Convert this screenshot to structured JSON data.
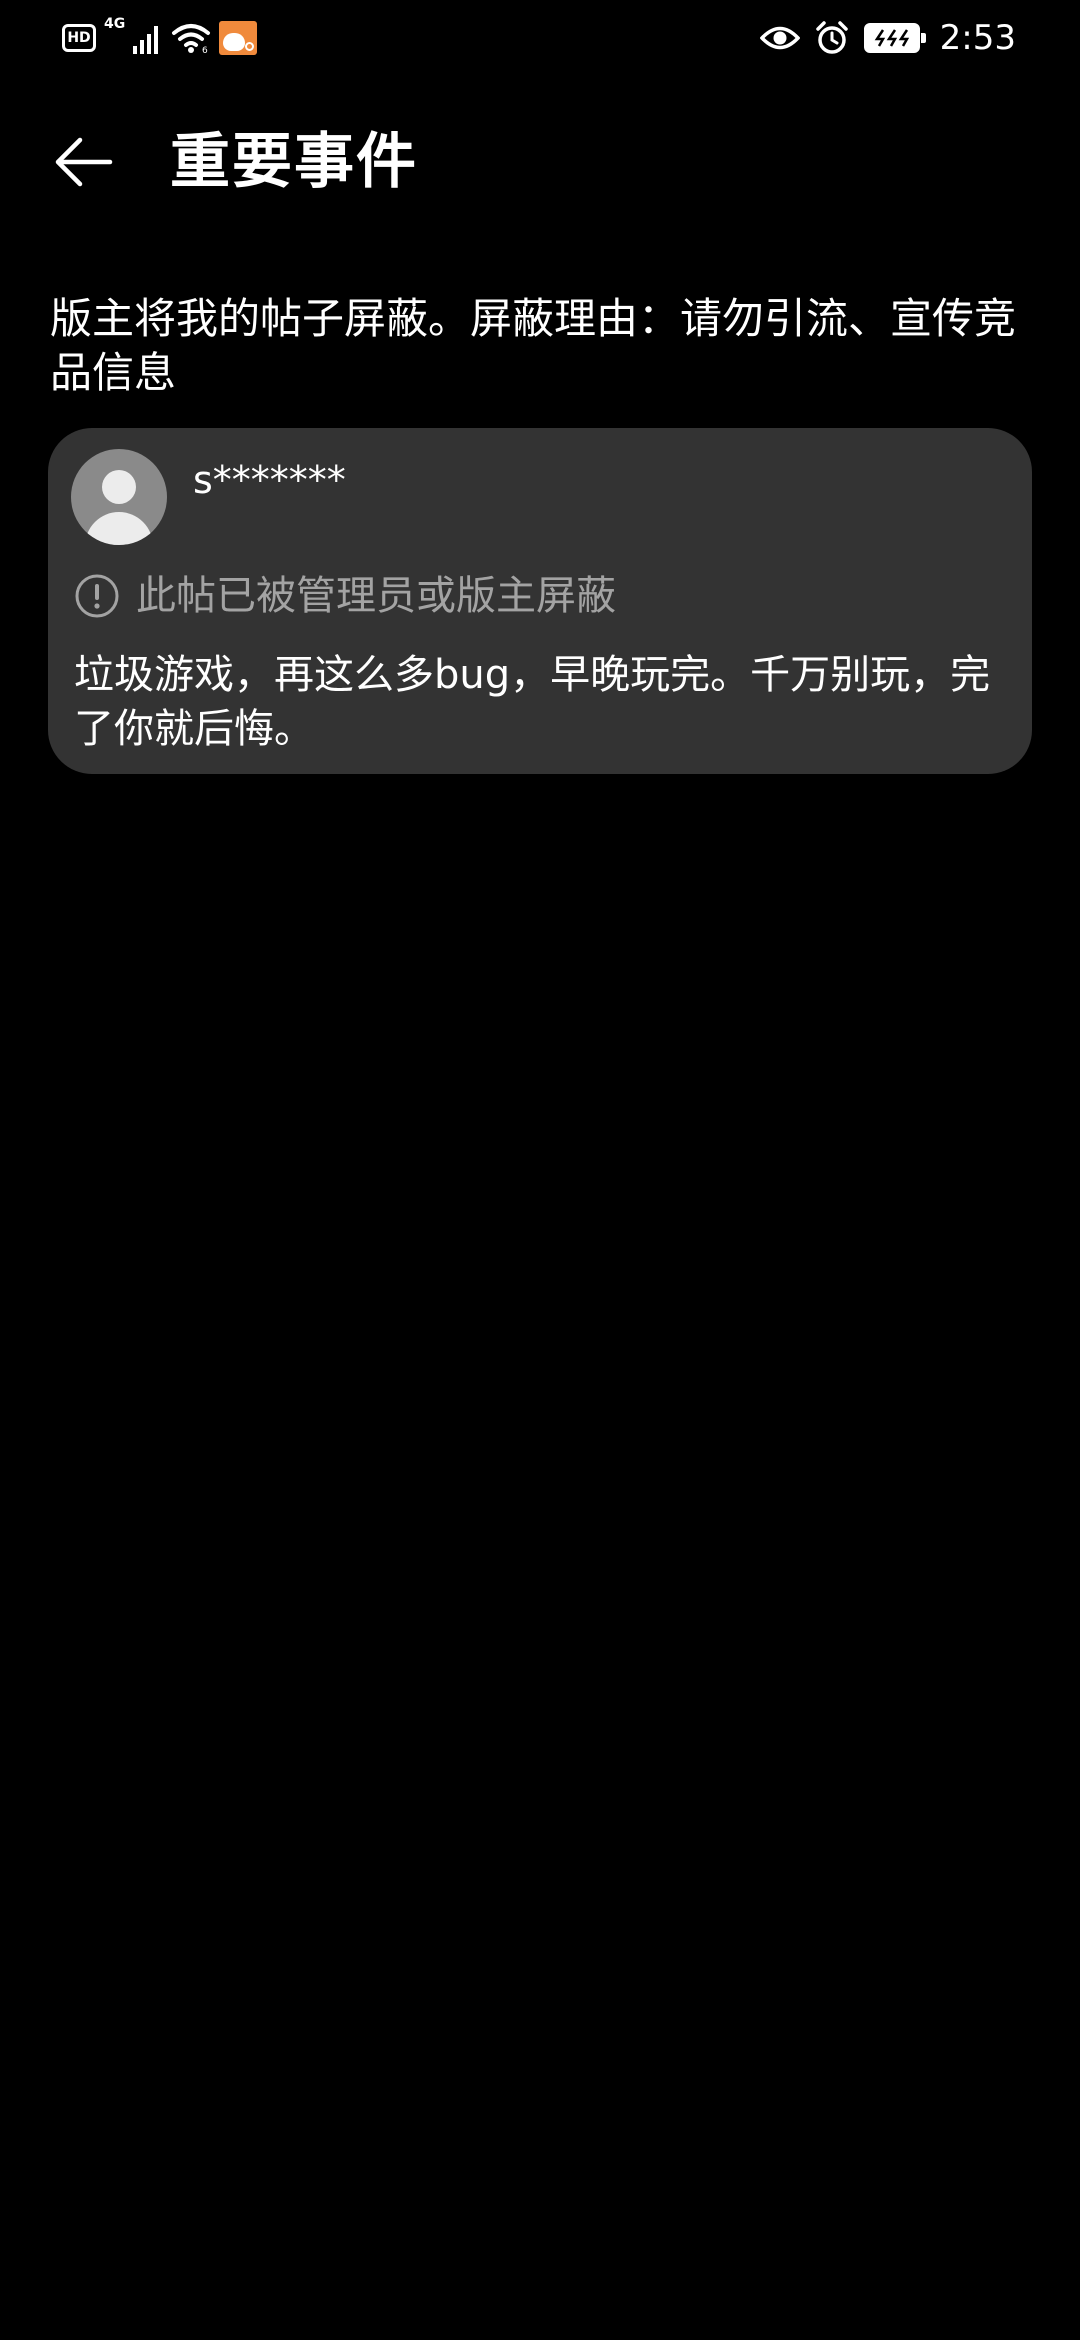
{
  "status_bar": {
    "hd_label": "HD",
    "network_type": "4G",
    "time": "2:53",
    "icons": [
      "hd-icon",
      "signal-icon",
      "wifi-icon",
      "app-notification-icon",
      "eye-comfort-icon",
      "alarm-icon",
      "battery-charging-icon"
    ]
  },
  "header": {
    "back_icon": "arrow-left-icon",
    "title": "重要事件"
  },
  "event": {
    "description": "版主将我的帖子屏蔽。屏蔽理由：请勿引流、宣传竞品信息"
  },
  "post": {
    "username": "s*******",
    "blocked_icon": "exclamation-circle-icon",
    "blocked_notice": "此帖已被管理员或版主屏蔽",
    "content": "垃圾游戏，再这么多bug，早晚玩完。千万别玩，完了你就后悔。"
  },
  "colors": {
    "background": "#000000",
    "card": "#333333",
    "text_primary": "#ffffff",
    "text_secondary": "#a3a3a3",
    "avatar_bg": "#8a8a8a"
  }
}
